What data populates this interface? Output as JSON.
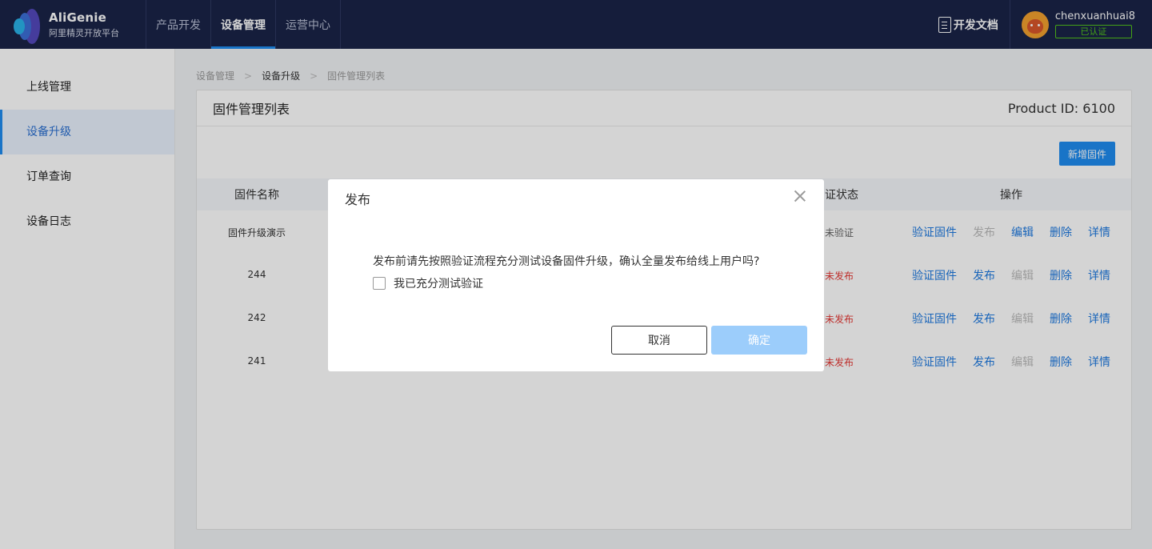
{
  "header": {
    "brand_name": "AliGenie",
    "brand_sub": "阿里精灵开放平台",
    "nav": [
      {
        "label": "产品开发"
      },
      {
        "label": "设备管理"
      },
      {
        "label": "运营中心"
      }
    ],
    "docs_label": "开发文档",
    "username": "chenxuanhuai8",
    "verified_label": "已认证"
  },
  "sidebar": {
    "items": [
      {
        "label": "上线管理"
      },
      {
        "label": "设备升级"
      },
      {
        "label": "订单查询"
      },
      {
        "label": "设备日志"
      }
    ]
  },
  "breadcrumb": [
    "设备管理",
    "设备升级",
    "固件管理列表"
  ],
  "card": {
    "title": "固件管理列表",
    "product_id": "Product ID: 6100",
    "add_button": "新增固件"
  },
  "table": {
    "columns": {
      "name": "固件名称",
      "status": "证状态",
      "ops": "操作"
    },
    "rows": [
      {
        "name": "固件升级演示",
        "status": "未验证",
        "ops": [
          "验证固件",
          "发布",
          "编辑",
          "删除",
          "详情"
        ]
      },
      {
        "name": "244",
        "status": "未发布",
        "ops": [
          "验证固件",
          "发布",
          "编辑",
          "删除",
          "详情"
        ]
      },
      {
        "name": "242",
        "status": "未发布",
        "ops": [
          "验证固件",
          "发布",
          "编辑",
          "删除",
          "详情"
        ]
      },
      {
        "name": "241",
        "status": "未发布",
        "ops": [
          "验证固件",
          "发布",
          "编辑",
          "删除",
          "详情"
        ]
      }
    ]
  },
  "modal": {
    "title": "发布",
    "message": "发布前请先按照验证流程充分测试设备固件升级，确认全量发布给线上用户吗?",
    "checkbox_label": "我已充分测试验证",
    "cancel": "取消",
    "confirm": "确定"
  },
  "colors": {
    "topbar": "#1a2447",
    "accent": "#1f8cf0",
    "link": "#1f7ae0",
    "error": "#e53935",
    "verified": "#52c41a",
    "confirm_disabled": "#9ccdfb"
  }
}
